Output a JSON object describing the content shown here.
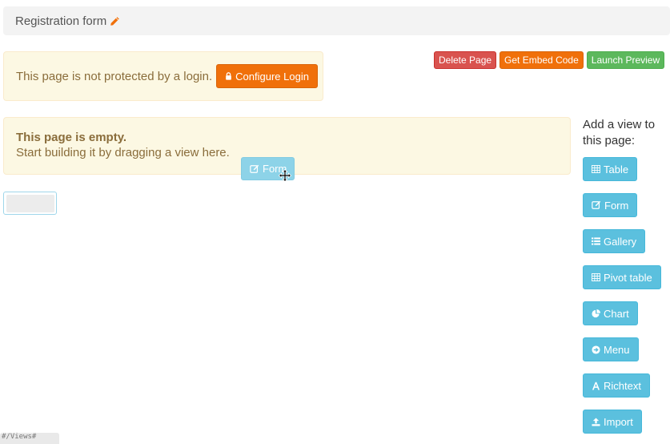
{
  "header": {
    "title": "Registration form",
    "edit_icon": "pencil-icon"
  },
  "login_notice": {
    "text": "This page is not protected by a login.",
    "configure_button": "Configure Login",
    "configure_icon": "lock-icon"
  },
  "top_actions": {
    "delete_page": "Delete Page",
    "get_embed_code": "Get Embed Code",
    "launch_preview": "Launch Preview"
  },
  "empty_notice": {
    "title": "This page is empty.",
    "subtitle": "Start building it by dragging a view here."
  },
  "drag_item": {
    "label": "Form",
    "icon": "edit-icon",
    "cursor": "move-cursor-icon"
  },
  "sidebar": {
    "heading_line1": "Add a view to",
    "heading_line2": "this page:",
    "views": [
      {
        "label": "Table",
        "icon": "table-icon"
      },
      {
        "label": "Form",
        "icon": "edit-icon"
      },
      {
        "label": "Gallery",
        "icon": "list-icon"
      },
      {
        "label": "Pivot table",
        "icon": "table-icon"
      },
      {
        "label": "Chart",
        "icon": "pie-chart-icon"
      },
      {
        "label": "Menu",
        "icon": "arrow-circle-icon"
      },
      {
        "label": "Richtext",
        "icon": "font-icon"
      },
      {
        "label": "Import",
        "icon": "upload-icon"
      }
    ]
  },
  "colors": {
    "orange": "#f0700a",
    "red": "#d9534f",
    "green": "#5cb85c",
    "info": "#5bc0de",
    "warning_bg": "#fcf8e3",
    "warning_text": "#8a6d3b"
  },
  "footer": {
    "url_fragment": "#/Views#"
  }
}
